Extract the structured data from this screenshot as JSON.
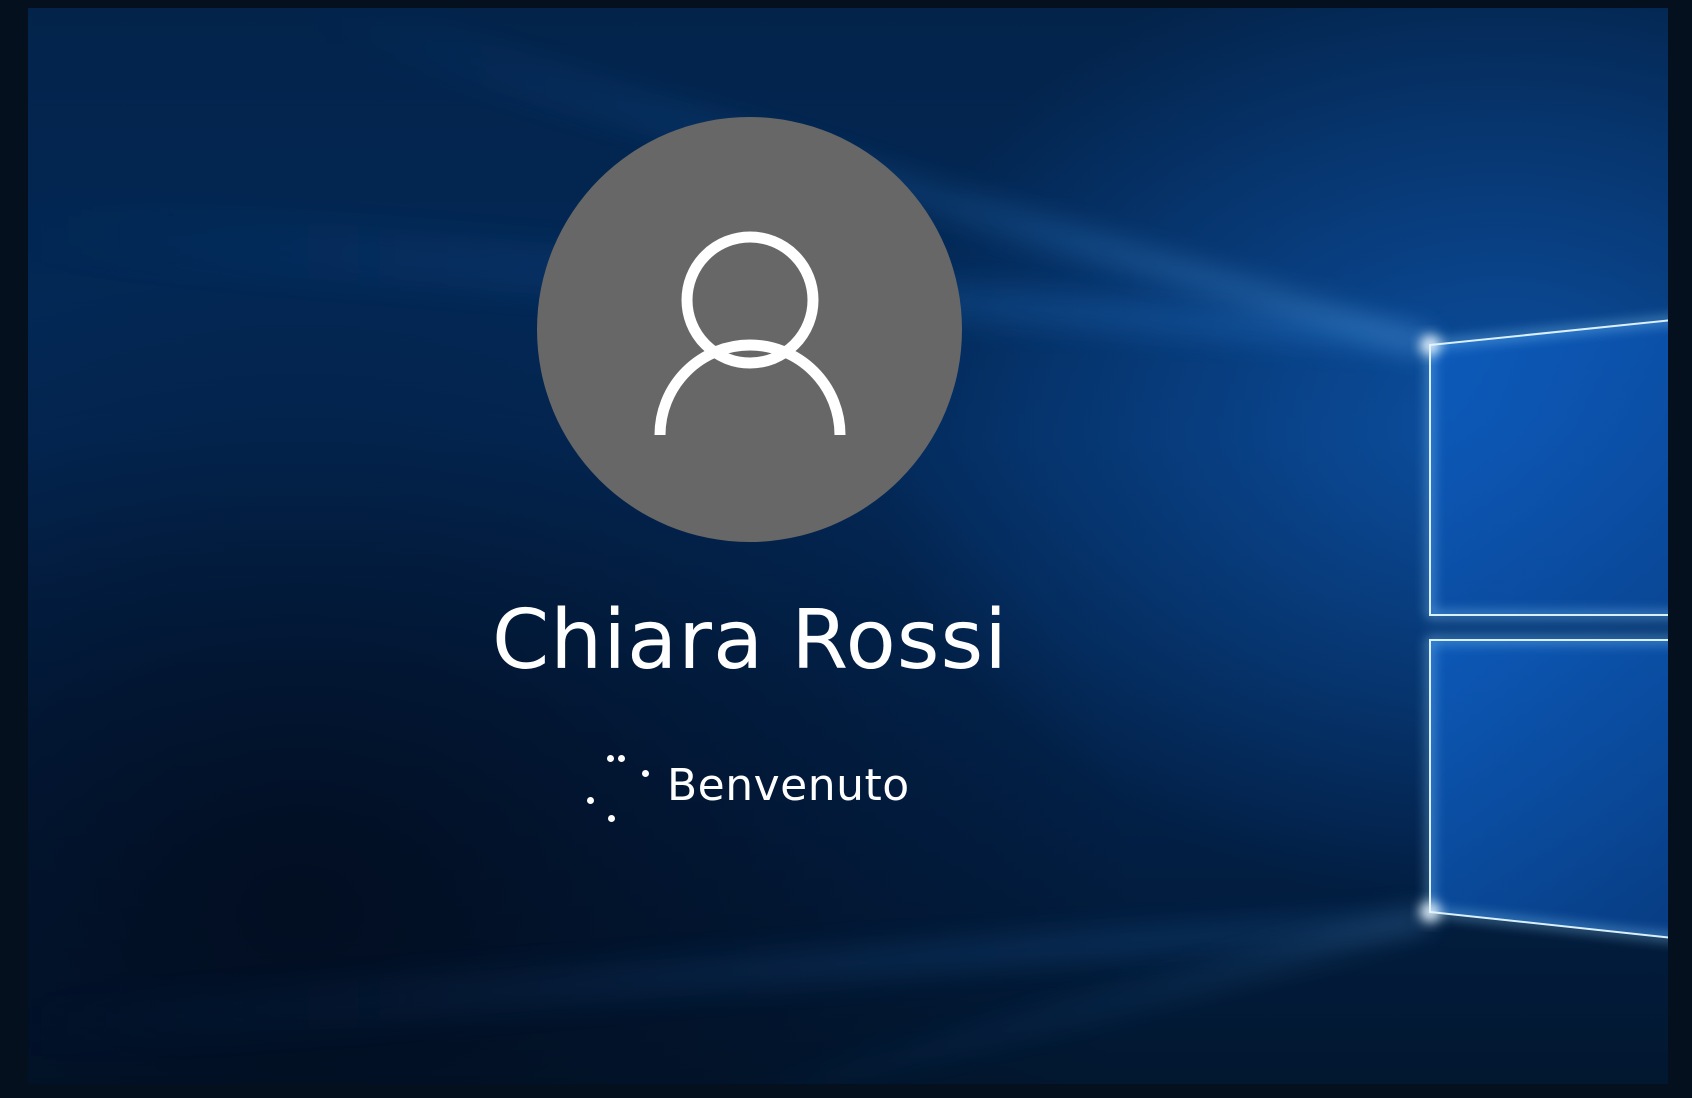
{
  "login_screen": {
    "user_name": "Chiara Rossi",
    "status_text": "Benvenuto"
  },
  "icons": {
    "avatar": "user-silhouette-icon",
    "spinner": "loading-dots-icon"
  },
  "colors": {
    "background": "#032a5a",
    "avatar_circle": "#676767",
    "text": "#ffffff",
    "light_beam": "#1e8cff"
  }
}
